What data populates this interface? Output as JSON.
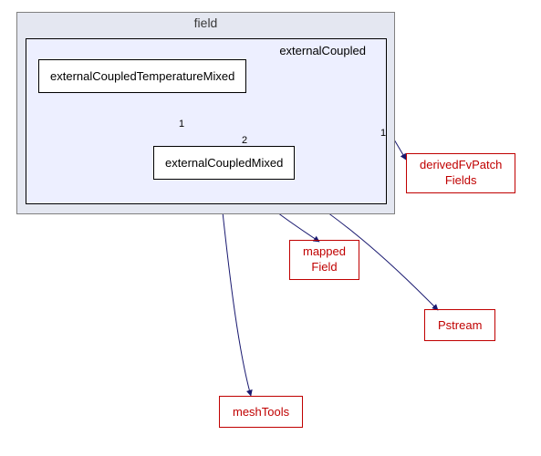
{
  "outer": {
    "label": "field"
  },
  "inner": {
    "label": "externalCoupled"
  },
  "nodes": {
    "ectm": "externalCoupledTemperatureMixed",
    "ecm": "externalCoupledMixed"
  },
  "red": {
    "right1": {
      "l1": "derivedFvPatch",
      "l2": "Fields"
    },
    "mid": {
      "l1": "mapped",
      "l2": "Field"
    },
    "right2": "Pstream",
    "bottom": "meshTools"
  },
  "edge_labels": {
    "ectm_ecm": "1",
    "inner_ecm": "2",
    "inner_right1": "1"
  },
  "chart_data": {
    "type": "diagram",
    "containers": [
      {
        "id": "field",
        "label": "field",
        "children": [
          "externalCoupled"
        ]
      },
      {
        "id": "externalCoupled",
        "label": "externalCoupled",
        "children": [
          "externalCoupledTemperatureMixed",
          "externalCoupledMixed"
        ]
      }
    ],
    "nodes": [
      {
        "id": "externalCoupledTemperatureMixed",
        "label": "externalCoupledTemperatureMixed"
      },
      {
        "id": "externalCoupledMixed",
        "label": "externalCoupledMixed"
      },
      {
        "id": "derivedFvPatchFields",
        "label": "derivedFvPatch Fields",
        "external": true
      },
      {
        "id": "mappedField",
        "label": "mapped Field",
        "external": true
      },
      {
        "id": "Pstream",
        "label": "Pstream",
        "external": true
      },
      {
        "id": "meshTools",
        "label": "meshTools",
        "external": true
      }
    ],
    "edges": [
      {
        "from": "externalCoupledTemperatureMixed",
        "to": "externalCoupledMixed",
        "label": "1"
      },
      {
        "from": "externalCoupled",
        "to": "externalCoupledMixed",
        "label": "2"
      },
      {
        "from": "externalCoupled",
        "to": "derivedFvPatchFields",
        "label": "1"
      },
      {
        "from": "externalCoupledMixed",
        "to": "mappedField"
      },
      {
        "from": "externalCoupledMixed",
        "to": "Pstream"
      },
      {
        "from": "externalCoupledMixed",
        "to": "meshTools"
      }
    ]
  }
}
